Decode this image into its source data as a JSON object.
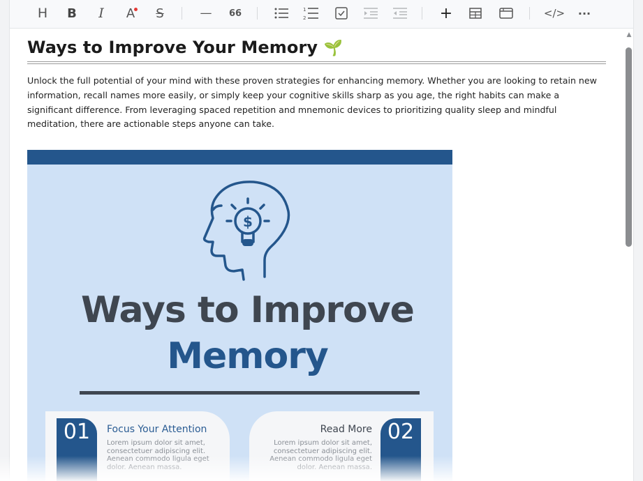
{
  "toolbar": {
    "items": [
      {
        "name": "heading",
        "glyph": "H"
      },
      {
        "name": "bold",
        "glyph": "B"
      },
      {
        "name": "italic",
        "glyph": "I"
      },
      {
        "name": "font-color",
        "glyph": "A"
      },
      {
        "name": "strikethrough",
        "glyph": "S"
      },
      {
        "name": "horizontal-rule",
        "glyph": "—"
      },
      {
        "name": "quote",
        "glyph": "66"
      },
      {
        "name": "bullet-list",
        "glyph": ""
      },
      {
        "name": "ordered-list",
        "glyph": ""
      },
      {
        "name": "task-list",
        "glyph": ""
      },
      {
        "name": "indent",
        "glyph": ""
      },
      {
        "name": "outdent",
        "glyph": ""
      },
      {
        "name": "insert",
        "glyph": "+"
      },
      {
        "name": "table",
        "glyph": ""
      },
      {
        "name": "embed",
        "glyph": ""
      },
      {
        "name": "code",
        "glyph": "</>"
      },
      {
        "name": "more",
        "glyph": "···"
      }
    ],
    "accent_color": "#e53935"
  },
  "document": {
    "title": "Ways to Improve Your Memory",
    "title_emoji": "🌱",
    "intro": "Unlock the full potential of your mind with these proven strategies for enhancing memory. Whether you are looking to retain new information, recall names more easily, or simply keep your cognitive skills sharp as you age, the right habits can make a significant difference. From leveraging spaced repetition and mnemonic devices to prioritizing quality sleep and mindful meditation, there are actionable steps anyone can take."
  },
  "infographic": {
    "headline_line1": "Ways to Improve",
    "headline_line2": "Memory",
    "icon": "head-lightbulb-dollar-icon",
    "colors": {
      "background": "#cfe1f6",
      "primary": "#24568c",
      "dark": "#3f4650"
    },
    "cards": [
      {
        "number": "01",
        "heading": "Focus Your Attention",
        "body": "Lorem ipsum dolor sit amet, consectetuer adipiscing elit. Aenean commodo ligula eget dolor. Aenean massa."
      },
      {
        "number": "02",
        "heading": "Read More",
        "body": "Lorem ipsum dolor sit amet, consectetuer adipiscing elit. Aenean commodo ligula eget dolor. Aenean massa."
      }
    ]
  }
}
